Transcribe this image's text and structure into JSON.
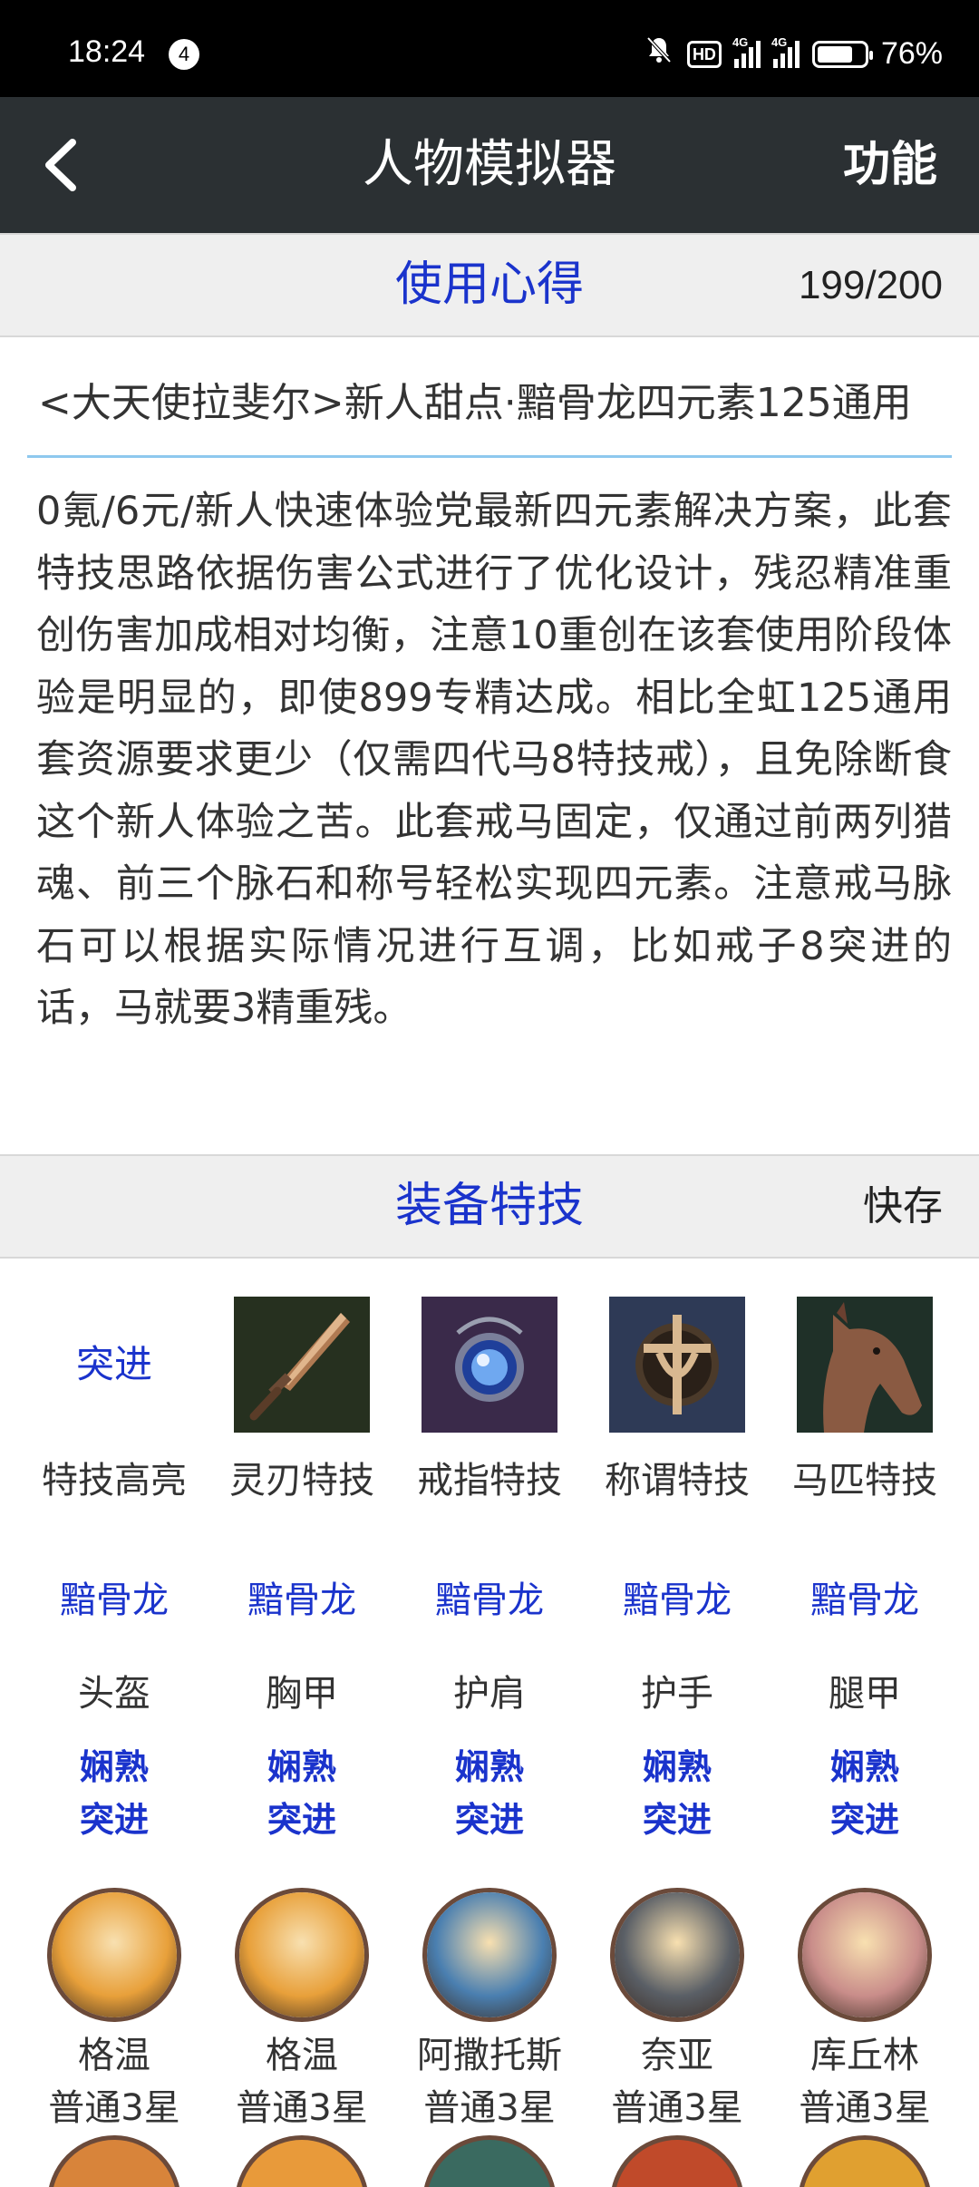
{
  "status_bar": {
    "time": "18:24",
    "notification_count": "4",
    "hd_label": "HD",
    "net1": "4G",
    "net2": "4G",
    "battery": "76%",
    "battery_level": 0.76
  },
  "header": {
    "title": "人物模拟器",
    "function_label": "功能"
  },
  "notes_section": {
    "title": "使用心得",
    "counter": "199/200"
  },
  "title_input": {
    "value": "<大天使拉斐尔>新人甜点·黯骨龙四元素125通用"
  },
  "description": "0氪/6元/新人快速体验党最新四元素解决方案，此套特技思路依据伤害公式进行了优化设计，残忍精准重创伤害加成相对均衡，注意10重创在该套使用阶段体验是明显的，即使899专精达成。相比全虹125通用套资源要求更少（仅需四代马8特技戒），且免除断食这个新人体验之苦。此套戒马固定，仅通过前两列猎魂、前三个脉石和称号轻松实现四元素。注意戒马脉石可以根据实际情况进行互调，比如戒子8突进的话，马就要3精重残。",
  "equip_section": {
    "title": "装备特技",
    "quick_save": "快存"
  },
  "skill_row": [
    {
      "value": "突进",
      "label": "特技高亮"
    },
    {
      "label": "灵刃特技",
      "icon": "dagger-icon"
    },
    {
      "label": "戒指特技",
      "icon": "ring-icon"
    },
    {
      "label": "称谓特技",
      "icon": "title-emblem-icon"
    },
    {
      "label": "马匹特技",
      "icon": "horse-icon"
    }
  ],
  "armor_row": [
    {
      "set": "黯骨龙",
      "slot": "头盔",
      "mod1": "娴熟",
      "mod2": "突进"
    },
    {
      "set": "黯骨龙",
      "slot": "胸甲",
      "mod1": "娴熟",
      "mod2": "突进"
    },
    {
      "set": "黯骨龙",
      "slot": "护肩",
      "mod1": "娴熟",
      "mod2": "突进"
    },
    {
      "set": "黯骨龙",
      "slot": "护手",
      "mod1": "娴熟",
      "mod2": "突进"
    },
    {
      "set": "黯骨龙",
      "slot": "腿甲",
      "mod1": "娴熟",
      "mod2": "突进"
    }
  ],
  "hero_row": [
    {
      "name": "格温",
      "grade": "普通3星",
      "color": "#e8a03a"
    },
    {
      "name": "格温",
      "grade": "普通3星",
      "color": "#e8a03a"
    },
    {
      "name": "阿撒托斯",
      "grade": "普通3星",
      "color": "#4a7fb0"
    },
    {
      "name": "奈亚",
      "grade": "普通3星",
      "color": "#5a5f66"
    },
    {
      "name": "库丘林",
      "grade": "普通3星",
      "color": "#c98d8a"
    }
  ],
  "colors": {
    "accent_blue": "#1a33cc",
    "header_bg": "#2b3033",
    "input_underline": "#8ec8ee"
  }
}
